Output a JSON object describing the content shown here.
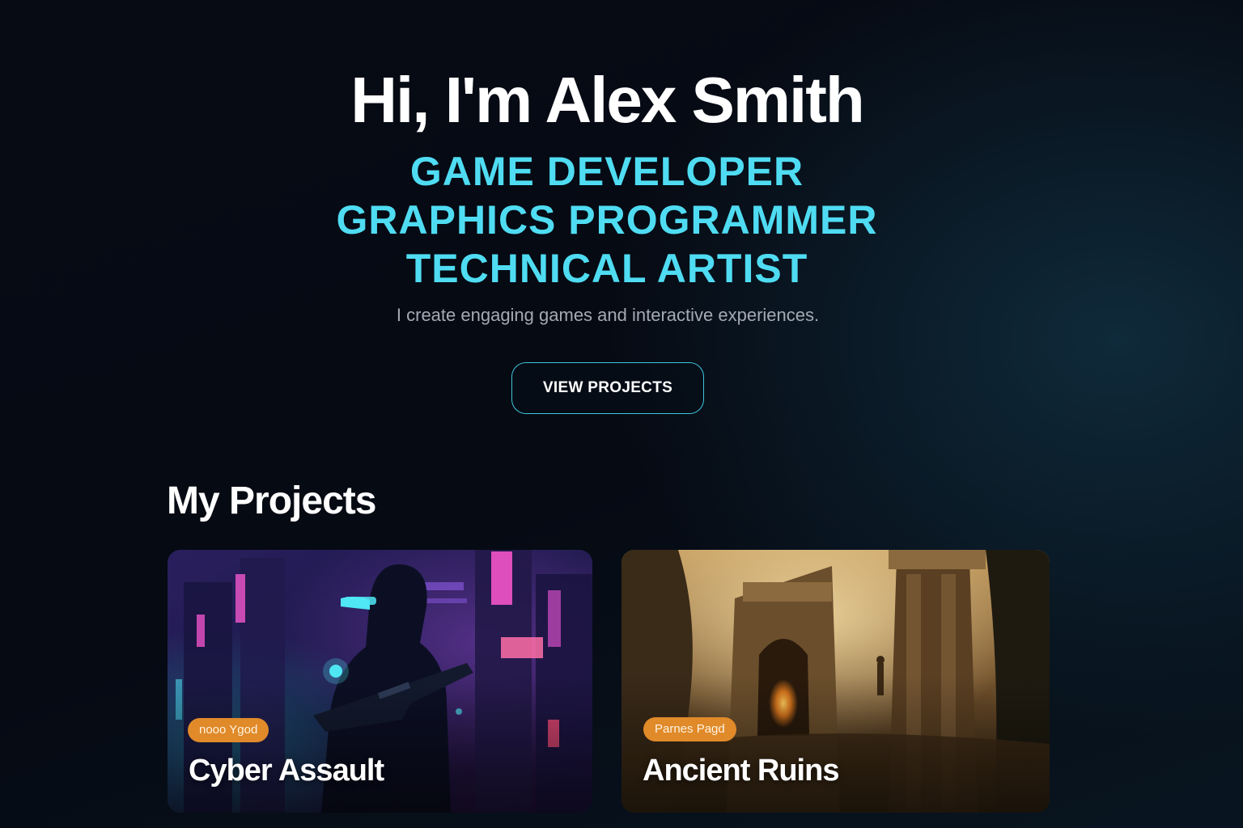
{
  "hero": {
    "title": "Hi, I'm Alex Smith",
    "roles": [
      "GAME DEVELOPER",
      "GRAPHICS PROGRAMMER",
      "TECHNICAL ARTIST"
    ],
    "tagline": "I create engaging games and interactive experiences.",
    "cta_label": "VIEW PROJECTS"
  },
  "projects": {
    "heading": "My Projects",
    "items": [
      {
        "badge": "nooo Ygod",
        "title": "Cyber Assault",
        "image": "cyberpunk-soldier-illustration"
      },
      {
        "badge": "Parnes Pagd",
        "title": "Ancient Ruins",
        "image": "ancient-ruins-illustration"
      }
    ]
  },
  "colors": {
    "accent": "#4fdcf2",
    "badge": "#e08a2a",
    "background": "#070b14"
  }
}
